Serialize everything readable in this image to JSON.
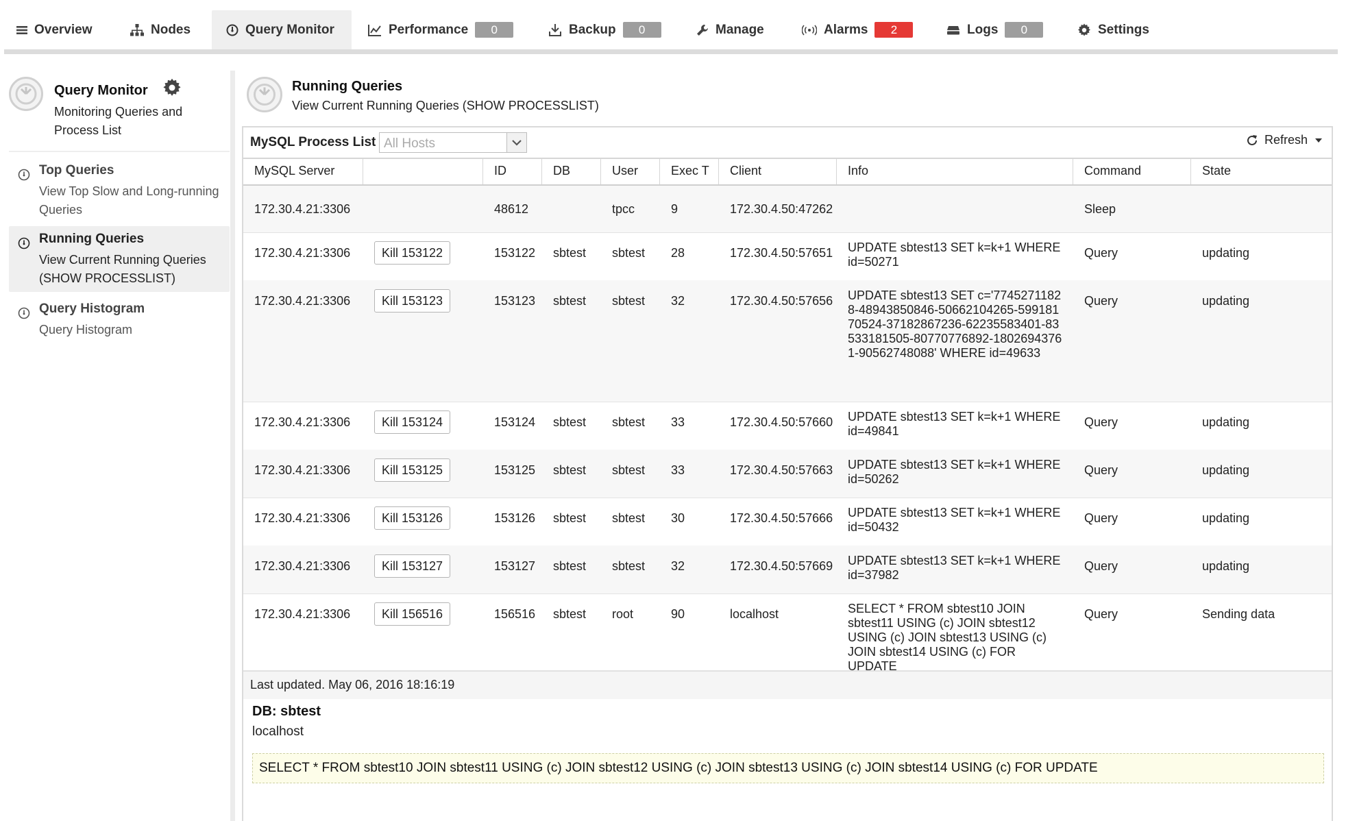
{
  "nav": {
    "items": [
      {
        "label": "Overview"
      },
      {
        "label": "Nodes"
      },
      {
        "label": "Query Monitor"
      },
      {
        "label": "Performance",
        "badge": "0"
      },
      {
        "label": "Backup",
        "badge": "0"
      },
      {
        "label": "Manage"
      },
      {
        "label": "Alarms",
        "badge": "2"
      },
      {
        "label": "Logs",
        "badge": "0"
      },
      {
        "label": "Settings"
      }
    ]
  },
  "sidebar": {
    "title": "Query Monitor",
    "description": "Monitoring Queries and Process List",
    "items": [
      {
        "title": "Top Queries",
        "desc": "View Top Slow and Long-running Queries"
      },
      {
        "title": "Running Queries",
        "desc": "View Current Running Queries (SHOW PROCESSLIST)"
      },
      {
        "title": "Query Histogram",
        "desc": "Query Histogram"
      }
    ]
  },
  "main": {
    "title": "Running Queries",
    "subtitle": "View Current Running Queries (SHOW PROCESSLIST)",
    "panel_label": "MySQL Process List",
    "host_select_placeholder": "All Hosts",
    "refresh_label": "Refresh",
    "columns": [
      "MySQL Server",
      "",
      "ID",
      "DB",
      "User",
      "Exec T",
      "Client",
      "Info",
      "Command",
      "State"
    ],
    "rows": [
      {
        "server": "172.30.4.21:3306",
        "kill": "",
        "id": "48612",
        "db": "",
        "user": "tpcc",
        "exec": "9",
        "client": "172.30.4.50:47262",
        "info": "",
        "command": "Sleep",
        "state": ""
      },
      {
        "server": "172.30.4.21:3306",
        "kill": "Kill 153122",
        "id": "153122",
        "db": "sbtest",
        "user": "sbtest",
        "exec": "28",
        "client": "172.30.4.50:57651",
        "info": "UPDATE sbtest13 SET k=k+1 WHERE id=50271",
        "command": "Query",
        "state": "updating"
      },
      {
        "server": "172.30.4.21:3306",
        "kill": "Kill 153123",
        "id": "153123",
        "db": "sbtest",
        "user": "sbtest",
        "exec": "32",
        "client": "172.30.4.50:57656",
        "info": "UPDATE sbtest13 SET c='77452711828-48943850846-50662104265-59918170524-37182867236-62235583401-83533181505-80770776892-18026943761-90562748088' WHERE id=49633",
        "command": "Query",
        "state": "updating"
      },
      {
        "server": "172.30.4.21:3306",
        "kill": "Kill 153124",
        "id": "153124",
        "db": "sbtest",
        "user": "sbtest",
        "exec": "33",
        "client": "172.30.4.50:57660",
        "info": "UPDATE sbtest13 SET k=k+1 WHERE id=49841",
        "command": "Query",
        "state": "updating"
      },
      {
        "server": "172.30.4.21:3306",
        "kill": "Kill 153125",
        "id": "153125",
        "db": "sbtest",
        "user": "sbtest",
        "exec": "33",
        "client": "172.30.4.50:57663",
        "info": "UPDATE sbtest13 SET k=k+1 WHERE id=50262",
        "command": "Query",
        "state": "updating"
      },
      {
        "server": "172.30.4.21:3306",
        "kill": "Kill 153126",
        "id": "153126",
        "db": "sbtest",
        "user": "sbtest",
        "exec": "30",
        "client": "172.30.4.50:57666",
        "info": "UPDATE sbtest13 SET k=k+1 WHERE id=50432",
        "command": "Query",
        "state": "updating"
      },
      {
        "server": "172.30.4.21:3306",
        "kill": "Kill 153127",
        "id": "153127",
        "db": "sbtest",
        "user": "sbtest",
        "exec": "32",
        "client": "172.30.4.50:57669",
        "info": "UPDATE sbtest13 SET k=k+1 WHERE id=37982",
        "command": "Query",
        "state": "updating"
      },
      {
        "server": "172.30.4.21:3306",
        "kill": "Kill 156516",
        "id": "156516",
        "db": "sbtest",
        "user": "root",
        "exec": "90",
        "client": "localhost",
        "info": "SELECT * FROM sbtest10 JOIN sbtest11 USING (c) JOIN sbtest12 USING (c) JOIN sbtest13 USING (c) JOIN sbtest14 USING (c) FOR UPDATE",
        "command": "Query",
        "state": "Sending data"
      }
    ],
    "last_updated": "Last updated. May 06, 2016 18:16:19",
    "detail": {
      "db": "DB: sbtest",
      "host": "localhost",
      "sql": "SELECT * FROM sbtest10 JOIN sbtest11 USING (c) JOIN sbtest12 USING (c) JOIN sbtest13 USING (c) JOIN sbtest14 USING (c) FOR UPDATE"
    }
  },
  "icons": {
    "overview": "list-icon",
    "nodes": "sitemap-icon",
    "query_monitor": "gauge-icon",
    "performance": "line-chart-icon",
    "backup": "download-icon",
    "manage": "wrench-icon",
    "alarms": "broadcast-icon",
    "logs": "stack-icon",
    "settings": "gear-icon",
    "refresh": "refresh-icon"
  },
  "colors": {
    "alarm_badge": "#e53935",
    "badge": "#9e9e9e",
    "sql_highlight": "#fdfde9"
  }
}
